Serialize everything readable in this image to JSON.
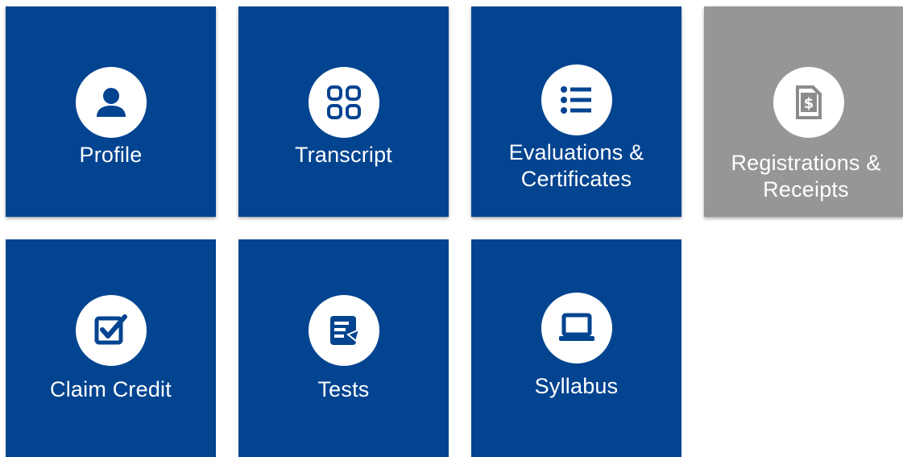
{
  "colors": {
    "tile_active": "#034490",
    "tile_disabled": "#969696",
    "icon_active": "#034490",
    "icon_disabled": "#8c8c8c",
    "page_background": "#ffffff"
  },
  "tiles": [
    {
      "lines": [
        "Profile"
      ],
      "icon": "user-icon",
      "state": "active"
    },
    {
      "lines": [
        "Transcript"
      ],
      "icon": "grid-icon",
      "state": "active"
    },
    {
      "lines": [
        "Evaluations &",
        "Certificates"
      ],
      "icon": "list-icon",
      "state": "active"
    },
    {
      "lines": [
        "Registrations &",
        "Receipts"
      ],
      "icon": "receipt-dollar-icon",
      "state": "disabled"
    },
    {
      "lines": [
        "Claim Credit"
      ],
      "icon": "checkbox-icon",
      "state": "active"
    },
    {
      "lines": [
        "Tests"
      ],
      "icon": "test-document-icon",
      "state": "active"
    },
    {
      "lines": [
        "Syllabus"
      ],
      "icon": "laptop-icon",
      "state": "active"
    }
  ]
}
